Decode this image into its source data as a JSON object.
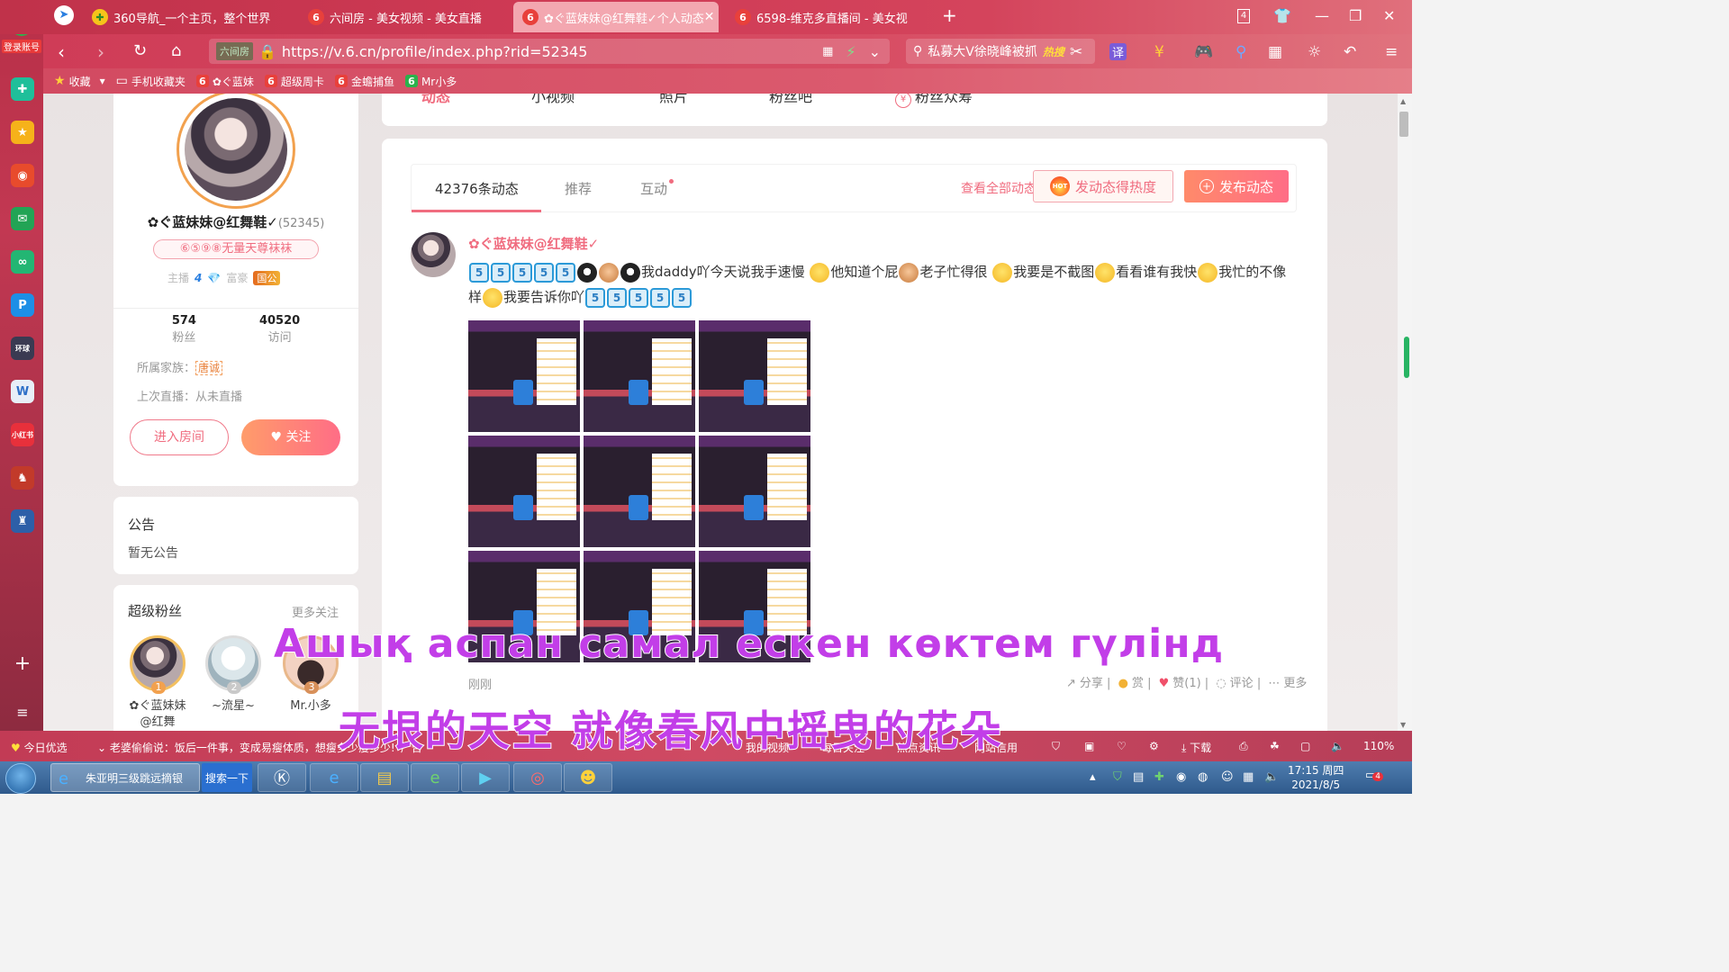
{
  "browser": {
    "tabs": [
      {
        "label": "360导航_一个主页，整个世界",
        "icon": "360-icon"
      },
      {
        "label": "六间房 - 美女视频 - 美女直播",
        "icon": "six-rooms-icon"
      },
      {
        "label": "✿ぐ蓝妹妹@红舞鞋✓个人动态",
        "icon": "six-rooms-icon"
      },
      {
        "label": "6598-维克多直播间 - 美女视",
        "icon": "six-rooms-icon"
      }
    ],
    "tab_counter": "4",
    "url": "https://v.6.cn/profile/index.php?rid=52345",
    "site_badge": "六间房",
    "search_text": "私募大V徐晓峰被抓",
    "search_hot": "热搜",
    "login_badge": "登录账号",
    "bookmarks": [
      {
        "label": "收藏",
        "icon": "star-icon"
      },
      {
        "label": "手机收藏夹",
        "icon": "folder-icon"
      },
      {
        "label": "✿ぐ蓝妹",
        "icon": "six-rooms-icon"
      },
      {
        "label": "超级周卡",
        "icon": "six-rooms-icon"
      },
      {
        "label": "金蟾捕鱼",
        "icon": "six-rooms-icon"
      },
      {
        "label": "Mr小多",
        "icon": "six-rooms-icon"
      }
    ]
  },
  "top_tabs": [
    "动态",
    "小视频",
    "照片",
    "粉丝吧",
    "粉丝众筹"
  ],
  "profile": {
    "name": "✿ぐ蓝妹妹@红舞鞋✓",
    "rid": "(52345)",
    "badge": "⑥⑤⑨⑧无量天尊袜袜",
    "anchor_label": "主播",
    "anchor_level": "4",
    "rich_label": "富豪",
    "rich_level": "国公",
    "fans_count": "574",
    "fans_label": "粉丝",
    "visits_count": "40520",
    "visits_label": "访问",
    "family_label": "所属家族：",
    "family_tag": "唐诚",
    "last_live": "上次直播：从未直播",
    "enter_room": "进入房间",
    "follow": "关注"
  },
  "notice": {
    "title": "公告",
    "content": "暂无公告"
  },
  "super_fans": {
    "title": "超级粉丝",
    "more": "更多关注",
    "fans": [
      {
        "rank": "1",
        "name": "✿ぐ蓝妹妹@红舞"
      },
      {
        "rank": "2",
        "name": "~流星~"
      },
      {
        "rank": "3",
        "name": "Mr.小多"
      }
    ]
  },
  "feed": {
    "tabs": [
      "42376条动态",
      "推荐",
      "互动"
    ],
    "view_all": "查看全部动态",
    "heat_button": "发动态得热度",
    "hot_tag": "HOT",
    "post_button": "发布动态",
    "post": {
      "author": "✿ぐ蓝妹妹@红舞鞋✓",
      "segments": [
        "我daddy吖今天说我手速慢",
        "他知道个屁",
        "老子忙得很",
        "我要是不截图",
        "看看谁有我快",
        "我忙的不像样",
        "我要告诉你吖"
      ],
      "time": "刚刚",
      "actions": [
        "分享",
        "赏",
        "赞(1)",
        "评论",
        "更多"
      ]
    }
  },
  "subtitles": {
    "line1": "Ашық аспан самал ескен көктем гүлінд",
    "line2": "无垠的天空 就像春风中摇曳的花朵"
  },
  "statusbar": {
    "items": [
      "今日优选",
      "老婆偷偷说：饭后一件事，变成易瘦体质，想瘦多少瘦多少!",
      "广告",
      "我的视频",
      "每日关注",
      "热点资讯",
      "网站信用",
      "下载",
      "110%"
    ]
  },
  "taskbar": {
    "ie_label": "朱亚明三级跳远摘银",
    "search_btn": "搜索一下",
    "time": "17:15 周四",
    "date": "2021/8/5",
    "notify_count": "4"
  }
}
